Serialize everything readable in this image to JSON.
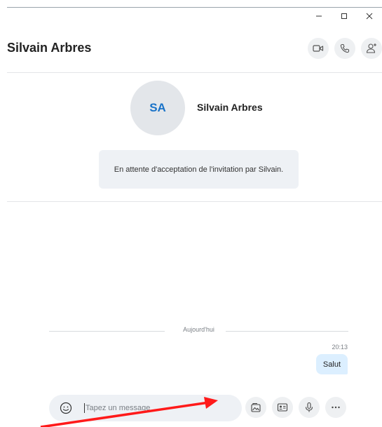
{
  "window": {
    "minimize_label": "−",
    "maximize_label": "□",
    "close_label": "×"
  },
  "header": {
    "title": "Silvain Arbres",
    "actions": [
      "video-call-icon",
      "audio-call-icon",
      "add-person-icon"
    ]
  },
  "profile": {
    "initials": "SA",
    "name": "Silvain Arbres"
  },
  "invite": {
    "text": "En attente d'acceptation de l'invitation par Silvain."
  },
  "conversation": {
    "day_label": "Aujourd'hui",
    "messages": [
      {
        "time": "20:13",
        "text": "Salut"
      }
    ]
  },
  "composer": {
    "placeholder": "Tapez un message",
    "tools": [
      "gallery-icon",
      "contact-card-icon",
      "microphone-icon",
      "more-icon"
    ]
  },
  "colors": {
    "accent": "#1a73c8",
    "bubble": "#dcefff",
    "arrow": "#ff1a1a"
  }
}
